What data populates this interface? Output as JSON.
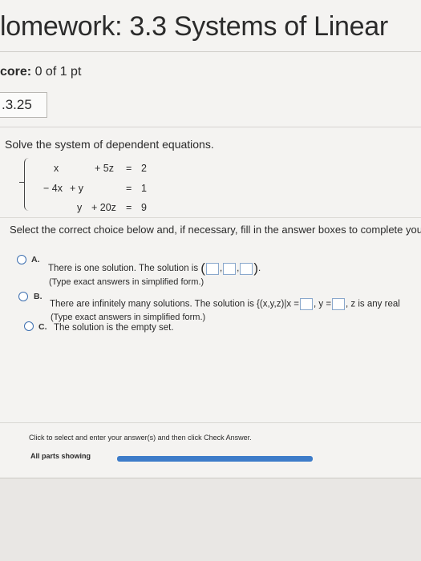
{
  "header": {
    "title": "lomework: 3.3 Systems of Linear",
    "score_label": "core:",
    "score_value": "0 of 1 pt"
  },
  "question": {
    "number": ".3.25",
    "prompt": "Solve the system of dependent equations.",
    "equations": {
      "row1": {
        "x": "x",
        "z": "+ 5z",
        "eq": "=",
        "rhs": "2"
      },
      "row2": {
        "x": "− 4x",
        "y": "+ y",
        "eq": "=",
        "rhs": "1"
      },
      "row3": {
        "y": "y",
        "z": "+ 20z",
        "eq": "=",
        "rhs": "9"
      }
    },
    "instruction": "Select the correct choice below and, if necessary, fill in the answer boxes to complete your c"
  },
  "choices": {
    "a": {
      "letter": "A.",
      "text": "There is one solution. The solution is",
      "hint": "(Type exact answers in simplified form.)"
    },
    "b": {
      "letter": "B.",
      "text": "There are infinitely many solutions. The solution is",
      "set_open": "{(x,y,z)|x =",
      "y_label": "y =",
      "z_label": ", z is any real",
      "hint": "(Type exact answers in simplified form.)"
    },
    "c": {
      "letter": "C.",
      "text": "The solution is the empty set."
    }
  },
  "footer": {
    "help_text": "Click to select and enter your answer(s) and then click Check Answer.",
    "parts_label": "All parts showing",
    "progress": 1.0
  },
  "colors": {
    "accent": "#3d7cc9",
    "radio_border": "#3d6fb0",
    "answer_box_border": "#8aa8cc"
  }
}
